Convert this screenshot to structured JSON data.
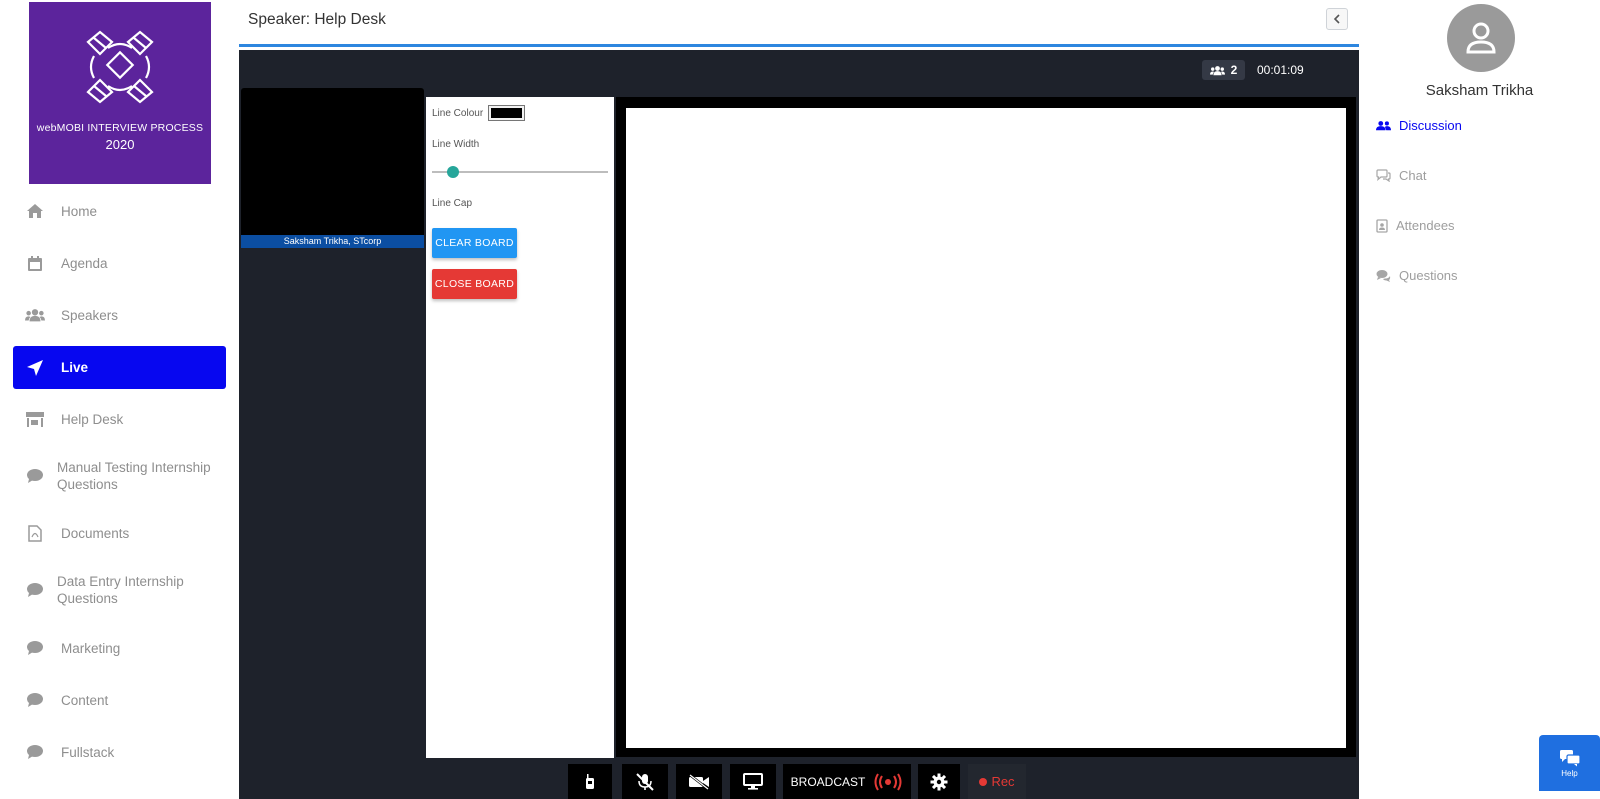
{
  "logo": {
    "line1": "webMOBI INTERVIEW PROCESS",
    "line2": "2020"
  },
  "nav": {
    "items": [
      {
        "label": "Home",
        "icon": "home-icon",
        "active": false
      },
      {
        "label": "Agenda",
        "icon": "calendar-icon",
        "active": false
      },
      {
        "label": "Speakers",
        "icon": "users-icon",
        "active": false
      },
      {
        "label": "Live",
        "icon": "paper-plane-icon",
        "active": true
      },
      {
        "label": "Help Desk",
        "icon": "store-icon",
        "active": false
      },
      {
        "label": "Manual Testing Internship Questions",
        "icon": "comment-icon",
        "active": false
      },
      {
        "label": "Documents",
        "icon": "pdf-file-icon",
        "active": false
      },
      {
        "label": "Data Entry Internship Questions",
        "icon": "comment-icon",
        "active": false
      },
      {
        "label": "Marketing",
        "icon": "comment-icon",
        "active": false
      },
      {
        "label": "Content",
        "icon": "comment-icon",
        "active": false
      },
      {
        "label": "Fullstack",
        "icon": "comment-icon",
        "active": false
      }
    ]
  },
  "header": {
    "title": "Speaker: Help Desk"
  },
  "stage": {
    "participant_count": "2",
    "timer": "00:01:09",
    "video_name": "Saksham Trikha, STcorp"
  },
  "whiteboard": {
    "line_colour_label": "Line Colour",
    "line_colour_value": "#000000",
    "line_width_label": "Line Width",
    "line_width_fraction": 0.12,
    "line_cap_label": "Line Cap",
    "clear_board_label": "CLEAR BOARD",
    "close_board_label": "CLOSE BOARD"
  },
  "controls": {
    "broadcast_label": "BROADCAST",
    "rec_label": "Rec"
  },
  "profile": {
    "name": "Saksham Trikha"
  },
  "panel_tabs": [
    {
      "label": "Discussion",
      "icon": "users-icon",
      "active": true
    },
    {
      "label": "Chat",
      "icon": "chat-icon",
      "active": false
    },
    {
      "label": "Attendees",
      "icon": "contact-book-icon",
      "active": false
    },
    {
      "label": "Questions",
      "icon": "comments-icon",
      "active": false
    }
  ],
  "help_widget": {
    "label": "Help"
  },
  "colors": {
    "sidebar_active": "#0707f0",
    "logo_bg": "#5c249c",
    "stage_bg": "#1e222b",
    "clear_button": "#2196f3",
    "close_button": "#e53935",
    "header_accent": "#2d86df"
  }
}
